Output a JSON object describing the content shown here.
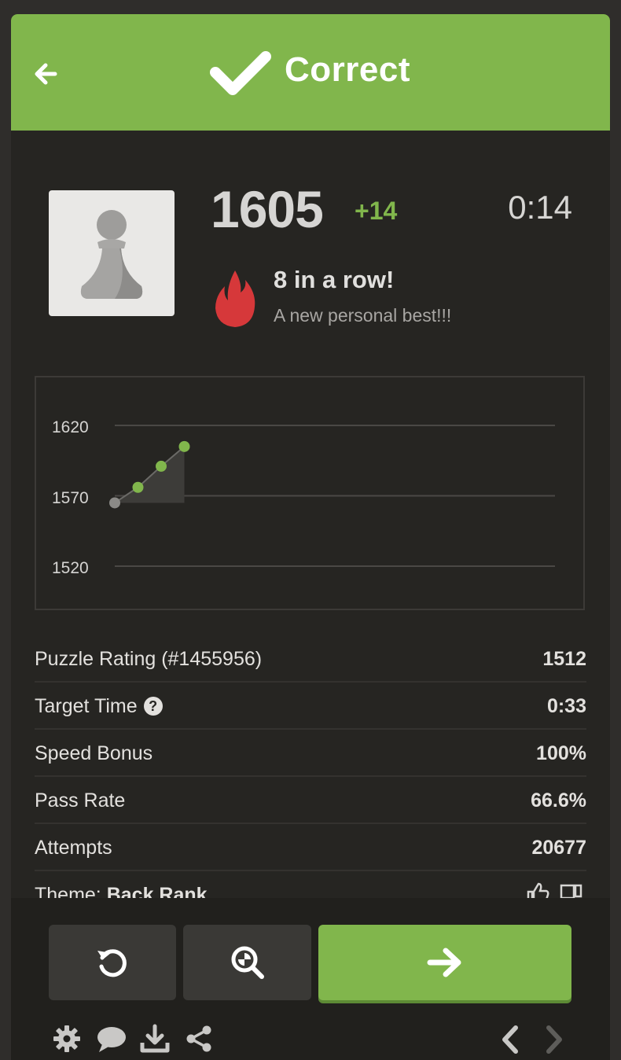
{
  "header": {
    "title": "Correct",
    "back_icon": "arrow-left-icon",
    "check_icon": "checkmark-icon",
    "color": "#81b64c"
  },
  "player": {
    "avatar_icon": "pawn-icon",
    "rating": "1605",
    "rating_delta": "+14",
    "timer": "0:14"
  },
  "streak": {
    "icon": "flame-icon",
    "title": "8 in a row!",
    "subtitle": "A new personal best!!!"
  },
  "chart_data": {
    "type": "line",
    "y_ticks": [
      "1620",
      "1570",
      "1520"
    ],
    "ylim": [
      1520,
      1620
    ],
    "points": [
      1565,
      1576,
      1591,
      1605
    ],
    "grid": true
  },
  "stats": [
    {
      "label": "Puzzle Rating (#1455956)",
      "value": "1512"
    },
    {
      "label": "Target Time",
      "value": "0:33",
      "help_icon": "question-icon"
    },
    {
      "label": "Speed Bonus",
      "value": "100%"
    },
    {
      "label": "Pass Rate",
      "value": "66.6%"
    },
    {
      "label": "Attempts",
      "value": "20677"
    }
  ],
  "theme": {
    "label": "Theme: ",
    "value": "Back Rank",
    "icons": [
      "thumbs-up-icon",
      "thumbs-down-icon"
    ]
  },
  "buttons": {
    "retry_icon": "retry-icon",
    "analyze_icon": "analysis-icon",
    "next_icon": "arrow-right-icon"
  },
  "toolbar": {
    "icons": [
      "gear-icon",
      "chat-icon",
      "download-icon",
      "share-icon",
      "chevron-left-icon",
      "chevron-right-icon"
    ]
  }
}
